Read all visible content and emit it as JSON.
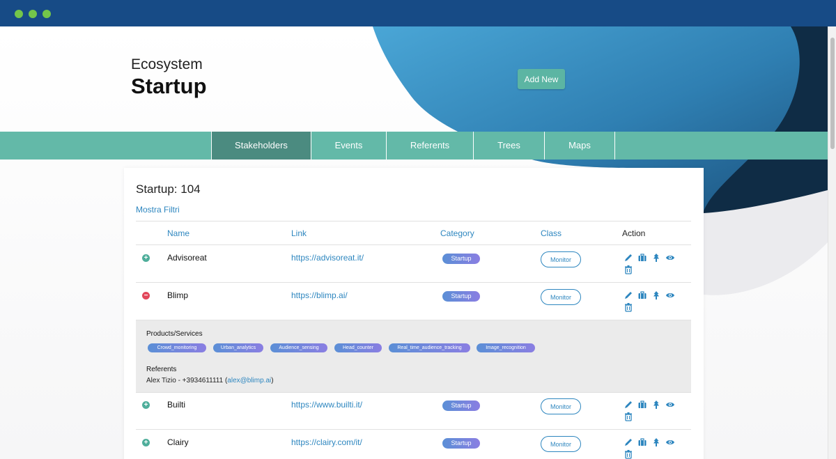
{
  "header": {
    "subtitle": "Ecosystem",
    "title": "Startup",
    "add_new_label": "Add New"
  },
  "nav": {
    "tabs": [
      {
        "label": "Stakeholders",
        "active": true
      },
      {
        "label": "Events"
      },
      {
        "label": "Referents"
      },
      {
        "label": "Trees"
      },
      {
        "label": "Maps"
      }
    ]
  },
  "card": {
    "title": "Startup: 104",
    "filters_link": "Mostra Filtri"
  },
  "table": {
    "columns": [
      "Name",
      "Link",
      "Category",
      "Class",
      "Action"
    ],
    "rows": [
      {
        "name": "Advisoreat",
        "link": "https://advisoreat.it/",
        "category": "Startup",
        "class": "Monitor",
        "expanded": false
      },
      {
        "name": "Blimp",
        "link": "https://blimp.ai/",
        "category": "Startup",
        "class": "Monitor",
        "expanded": true
      },
      {
        "name": "Builti",
        "link": "https://www.builti.it/",
        "category": "Startup",
        "class": "Monitor",
        "expanded": false
      },
      {
        "name": "Clairy",
        "link": "https://clairy.com/it/",
        "category": "Startup",
        "class": "Monitor",
        "expanded": false
      }
    ],
    "actions": [
      "pencil-icon",
      "briefcase-icon",
      "tree-icon",
      "eye-icon",
      "trash-icon"
    ]
  },
  "detail": {
    "products_label": "Products/Services",
    "tags": [
      "Crowd_monitoring",
      "Urban_analytics",
      "Audience_sensing",
      "Head_counter",
      "Real_time_audience_tracking",
      "Image_recognition"
    ],
    "referents_label": "Referents",
    "referent_text": "Alex Tizio - +3934611111 (",
    "referent_email": "alex@blimp.ai",
    "referent_close": ")"
  },
  "colors": {
    "titlebar": "#174b86",
    "window_dots": "#74c64a",
    "nav": "#63b9a8",
    "nav_active": "#4b8b80",
    "accent_blue": "#2d86bf",
    "plus": "#4fae9b",
    "minus": "#e2475a"
  }
}
